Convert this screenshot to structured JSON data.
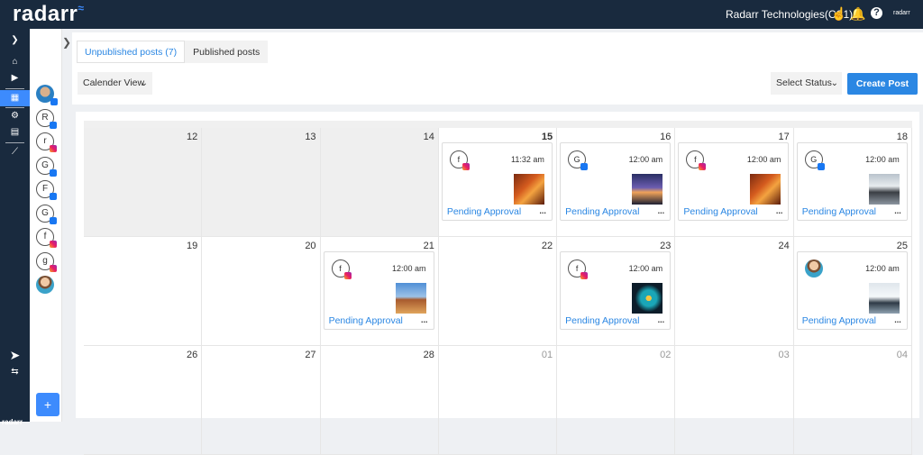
{
  "app": {
    "logo": "radarr",
    "org": "Radarr Technologies(CS1)",
    "brand_small": "radarr",
    "footer_brand": "radarr"
  },
  "colors": {
    "primary": "#2b87e3",
    "nav": "#192a3e",
    "pending": "#2b87e3"
  },
  "topbar_icons": [
    "touch-icon",
    "bell-icon",
    "help-icon"
  ],
  "rail_icons": [
    "chevron-right-icon",
    "home-icon",
    "video-icon",
    "dashboard-icon",
    "settings-icon",
    "content-icon",
    "analytics-icon",
    "send-icon",
    "swap-icon"
  ],
  "profiles": [
    {
      "letter": "",
      "network": "fb",
      "avatar": "avatar"
    },
    {
      "letter": "R",
      "network": "fb"
    },
    {
      "letter": "r",
      "network": "ig"
    },
    {
      "letter": "G",
      "network": "fb"
    },
    {
      "letter": "F",
      "network": "fb"
    },
    {
      "letter": "G",
      "network": "fb"
    },
    {
      "letter": "f",
      "network": "ig"
    },
    {
      "letter": "g",
      "network": "ig"
    },
    {
      "letter": "",
      "network": "",
      "avatar": "avatar2"
    }
  ],
  "tabs": [
    {
      "label": "Unpublished posts (7)",
      "active": true
    },
    {
      "label": "Published posts",
      "active": false
    }
  ],
  "view_select": {
    "value": "Calender View"
  },
  "status_select": {
    "value": "Select Status"
  },
  "create_button": "Create Post",
  "weeks": [
    [
      {
        "day": "12",
        "past": true,
        "muted": false
      },
      {
        "day": "13",
        "past": true,
        "muted": false
      },
      {
        "day": "14",
        "past": true,
        "muted": false
      },
      {
        "day": "15",
        "today": true,
        "post": {
          "avatar": "f",
          "network": "ig",
          "time": "11:32 am",
          "thumb": "th-food",
          "status": "Pending Approval"
        }
      },
      {
        "day": "16",
        "post": {
          "avatar": "G",
          "network": "fb",
          "time": "12:00 am",
          "thumb": "th-sunset",
          "status": "Pending Approval"
        }
      },
      {
        "day": "17",
        "post": {
          "avatar": "f",
          "network": "ig",
          "time": "12:00 am",
          "thumb": "th-food",
          "status": "Pending Approval"
        }
      },
      {
        "day": "18",
        "post": {
          "avatar": "G",
          "network": "fb",
          "time": "12:00 am",
          "thumb": "th-car",
          "status": "Pending Approval"
        }
      }
    ],
    [
      {
        "day": "19"
      },
      {
        "day": "20"
      },
      {
        "day": "21",
        "post": {
          "avatar": "f",
          "network": "ig",
          "time": "12:00 am",
          "thumb": "th-desert",
          "status": "Pending Approval"
        }
      },
      {
        "day": "22"
      },
      {
        "day": "23",
        "post": {
          "avatar": "f",
          "network": "ig",
          "time": "12:00 am",
          "thumb": "th-art",
          "status": "Pending Approval"
        }
      },
      {
        "day": "24"
      },
      {
        "day": "25",
        "post": {
          "avatar": "img",
          "network": "",
          "time": "12:00 am",
          "thumb": "th-snow",
          "status": "Pending Approval"
        }
      }
    ],
    [
      {
        "day": "26"
      },
      {
        "day": "27"
      },
      {
        "day": "28"
      },
      {
        "day": "01",
        "muted": true
      },
      {
        "day": "02",
        "muted": true
      },
      {
        "day": "03",
        "muted": true
      },
      {
        "day": "04",
        "muted": true
      }
    ]
  ],
  "post_more": "..."
}
